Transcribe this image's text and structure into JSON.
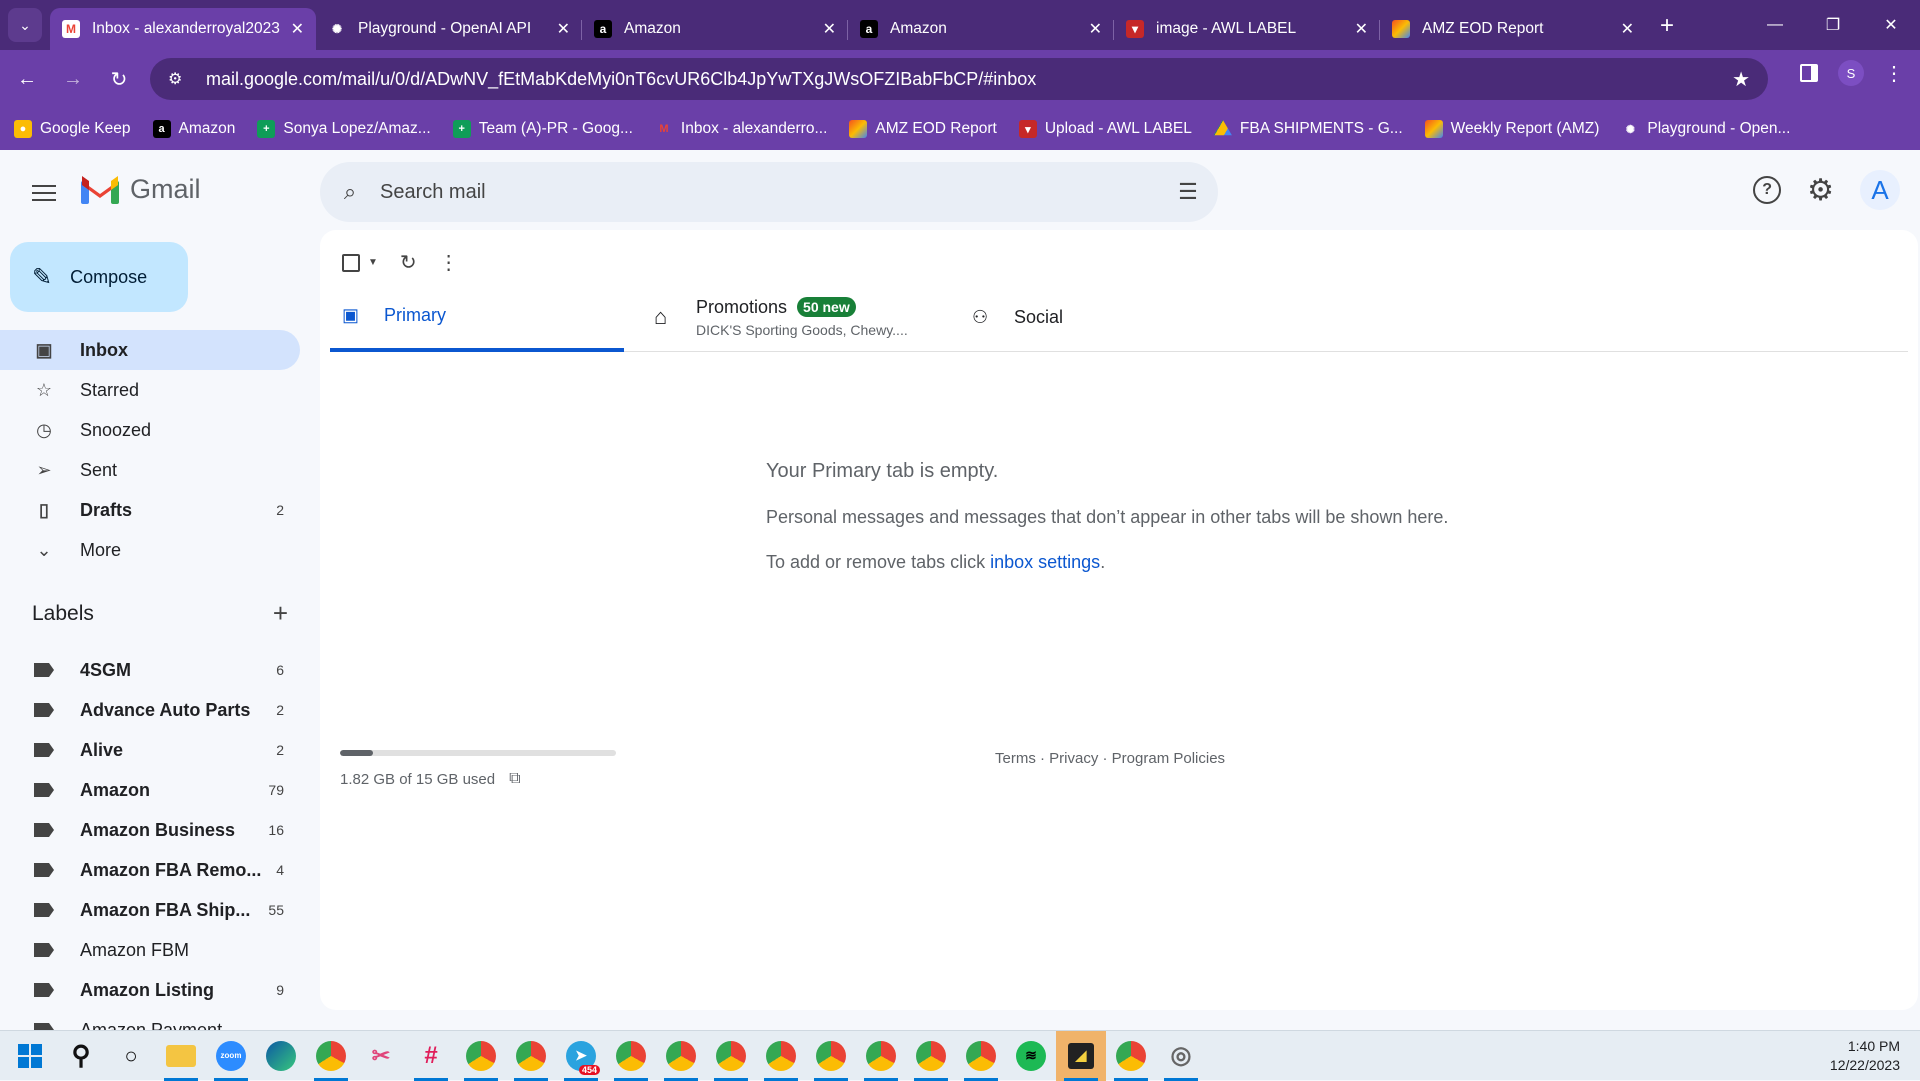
{
  "browser": {
    "tabs": [
      {
        "title": "Inbox - alexanderroyal2023",
        "icon": "gmail-icon",
        "active": true
      },
      {
        "title": "Playground - OpenAI API",
        "icon": "openai-icon",
        "active": false
      },
      {
        "title": "Amazon",
        "icon": "amazon-icon",
        "active": false
      },
      {
        "title": "Amazon",
        "icon": "amazon-icon",
        "active": false
      },
      {
        "title": "image - AWL LABEL",
        "icon": "awl-icon",
        "active": false
      },
      {
        "title": "AMZ EOD Report",
        "icon": "report-icon",
        "active": false
      }
    ],
    "url": "mail.google.com/mail/u/0/d/ADwNV_fEtMabKdeMyi0nT6cvUR6Clb4JpYwTXgJWsOFZIBabFbCP/#inbox",
    "profile_initial": "S",
    "bookmarks": [
      {
        "label": "Google Keep",
        "icon": "keep-icon"
      },
      {
        "label": "Amazon",
        "icon": "amazon-icon"
      },
      {
        "label": "Sonya Lopez/Amaz...",
        "icon": "sheets-icon"
      },
      {
        "label": "Team (A)-PR - Goog...",
        "icon": "sheets-icon"
      },
      {
        "label": "Inbox - alexanderro...",
        "icon": "gmail-icon"
      },
      {
        "label": "AMZ EOD Report",
        "icon": "report-icon"
      },
      {
        "label": "Upload - AWL LABEL",
        "icon": "awl-icon"
      },
      {
        "label": "FBA SHIPMENTS - G...",
        "icon": "drive-icon"
      },
      {
        "label": "Weekly Report (AMZ)",
        "icon": "report-icon"
      },
      {
        "label": "Playground - Open...",
        "icon": "openai-icon"
      }
    ]
  },
  "gmail": {
    "brand": "Gmail",
    "search_placeholder": "Search mail",
    "avatar_initial": "A",
    "compose_label": "Compose",
    "nav": [
      {
        "label": "Inbox",
        "count": "",
        "icon": "inbox-icon",
        "active": true,
        "bold": true
      },
      {
        "label": "Starred",
        "count": "",
        "icon": "star-icon",
        "active": false,
        "bold": false
      },
      {
        "label": "Snoozed",
        "count": "",
        "icon": "clock-icon",
        "active": false,
        "bold": false
      },
      {
        "label": "Sent",
        "count": "",
        "icon": "send-icon",
        "active": false,
        "bold": false
      },
      {
        "label": "Drafts",
        "count": "2",
        "icon": "draft-icon",
        "active": false,
        "bold": true
      },
      {
        "label": "More",
        "count": "",
        "icon": "chevron-down-icon",
        "active": false,
        "bold": false
      }
    ],
    "labels_title": "Labels",
    "labels": [
      {
        "label": "4SGM",
        "count": "6",
        "bold": true
      },
      {
        "label": "Advance Auto Parts",
        "count": "2",
        "bold": true
      },
      {
        "label": "Alive",
        "count": "2",
        "bold": true
      },
      {
        "label": "Amazon",
        "count": "79",
        "bold": true
      },
      {
        "label": "Amazon Business",
        "count": "16",
        "bold": true
      },
      {
        "label": "Amazon FBA Remo...",
        "count": "4",
        "bold": true
      },
      {
        "label": "Amazon FBA Ship...",
        "count": "55",
        "bold": true
      },
      {
        "label": "Amazon FBM",
        "count": "",
        "bold": false
      },
      {
        "label": "Amazon Listing",
        "count": "9",
        "bold": true
      },
      {
        "label": "Amazon Payment",
        "count": "",
        "bold": false
      }
    ],
    "tabs": {
      "primary": "Primary",
      "promotions": "Promotions",
      "promotions_badge": "50 new",
      "promotions_sub": "DICK'S Sporting Goods, Chewy....",
      "social": "Social"
    },
    "empty": {
      "heading": "Your Primary tab is empty.",
      "line1": "Personal messages and messages that don’t appear in other tabs will be shown here.",
      "line2_prefix": "To add or remove tabs click ",
      "line2_link": "inbox settings",
      "line2_suffix": "."
    },
    "storage": {
      "text": "1.82 GB of 15 GB used",
      "used_fraction": 0.121
    },
    "footer": "Terms · Privacy · Program Policies"
  },
  "taskbar": {
    "time": "1:40 PM",
    "date": "12/22/2023",
    "telegram_badge": "454"
  }
}
